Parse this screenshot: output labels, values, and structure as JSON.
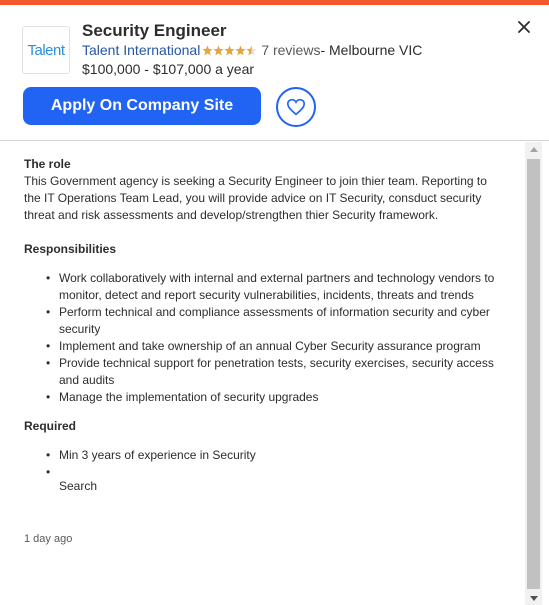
{
  "colors": {
    "accent_bar": "#f1592a",
    "primary_button": "#2164f3",
    "link": "#2557a7",
    "star": "#e8a33d"
  },
  "job": {
    "title": "Security Engineer",
    "company_logo_text": "Talent",
    "company": "Talent International",
    "rating": 4.5,
    "reviews": "7 reviews",
    "location_sep": " - Melbourne VIC",
    "salary": "$100,000 - $107,000 a year"
  },
  "actions": {
    "apply_label": "Apply On Company Site",
    "save_icon": "heart-icon",
    "close_icon": "close-icon"
  },
  "description": {
    "role_heading": "The role",
    "role_text": "This Government agency is seeking a Security Engineer to join thier team. Reporting to the IT Operations Team Lead, you will provide advice on IT Security, consduct security threat and risk assessments and develop/strengthen thier Security framework.",
    "responsibilities_heading": "Responsibilities",
    "responsibilities": [
      "Work collaboratively with internal and external partners and technology vendors to monitor, detect and report security vulnerabilities, incidents, threats and trends",
      "Perform technical and compliance assessments of information security and cyber security",
      "Implement and take ownership of an annual Cyber Security assurance program",
      "Provide technical support for penetration tests, security exercises, security access and audits",
      "Manage the implementation of security upgrades"
    ],
    "required_heading": "Required",
    "required": [
      "Min 3 years of experience in Security",
      ""
    ],
    "search_text": "Search",
    "posted": "1 day ago"
  }
}
